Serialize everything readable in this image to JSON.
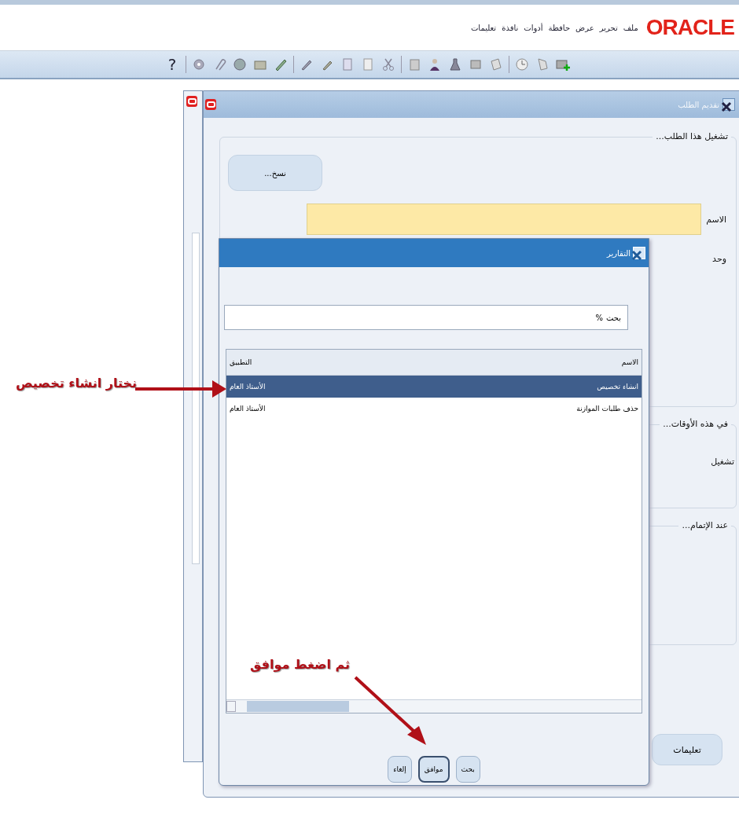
{
  "menu_bar": {
    "logo": "ORACLE",
    "items": [
      "ملف",
      "تحرير",
      "عرض",
      "حافظة",
      "أدوات",
      "نافذة",
      "تعليمات"
    ]
  },
  "toolbar": {
    "help": "?"
  },
  "window": {
    "title": "تقديم الطلب",
    "run_group": {
      "title": "تشغيل هذا الطلب...",
      "copy_button": "نسخ...",
      "name_label": "الاسم",
      "unit_label": "وحد"
    },
    "schedule_group": {
      "title": "في هذه الأوقات...",
      "run_label": "تشغيل"
    },
    "completion_group": {
      "title": "عند الإتمام..."
    },
    "help_button": "تعليمات"
  },
  "dialog": {
    "title": "التقارير",
    "search_label": "بحث",
    "search_value": "%",
    "columns": [
      "الاسم",
      "التطبيق"
    ],
    "rows": [
      {
        "name": "انشاء تخصيص",
        "application": "الأستاذ العام",
        "selected": true
      },
      {
        "name": "حذف طلبات الموازنة",
        "application": "الأستاذ العام",
        "selected": false
      }
    ],
    "buttons": [
      {
        "label": "بحث",
        "focused": false
      },
      {
        "label": "موافق",
        "focused": true
      },
      {
        "label": "إلغاء",
        "focused": false
      }
    ]
  },
  "annotations": [
    {
      "text": "نختار انشاء تخصيص"
    },
    {
      "text": "ثم اضغط موافق"
    }
  ]
}
